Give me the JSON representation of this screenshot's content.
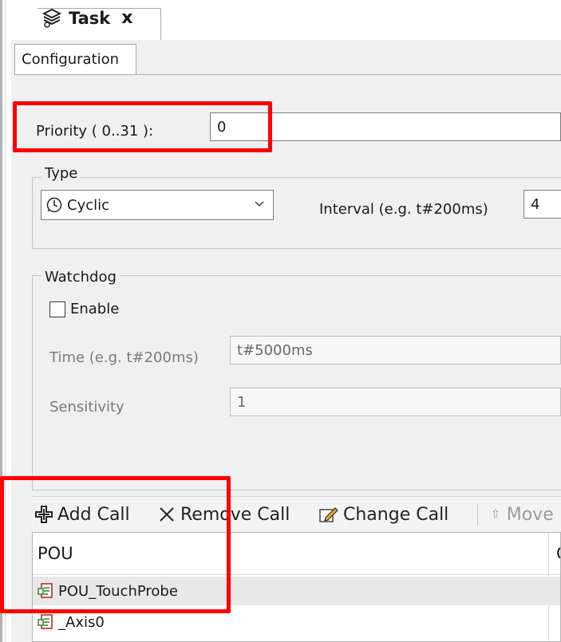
{
  "tab": {
    "title": "Task",
    "close_glyph": "x"
  },
  "config_tab": {
    "label": "Configuration"
  },
  "priority": {
    "label": "Priority ( 0..31 ):",
    "value": "0"
  },
  "type_group": {
    "legend": "Type",
    "selected": "Cyclic",
    "interval_label": "Interval (e.g. t#200ms)",
    "interval_value": "4"
  },
  "watchdog": {
    "legend": "Watchdog",
    "enable_label": "Enable",
    "enabled": false,
    "time_label": "Time (e.g. t#200ms)",
    "time_value": "t#5000ms",
    "sensitivity_label": "Sensitivity",
    "sensitivity_value": "1"
  },
  "toolbar": {
    "add": "Add Call",
    "remove": "Remove Call",
    "change": "Change Call",
    "move": "Move"
  },
  "table": {
    "headers": [
      "POU",
      "C"
    ],
    "rows": [
      "POU_TouchProbe",
      "_Axis0"
    ]
  },
  "colors": {
    "highlight": "#ff0000",
    "panel": "#f0f0f0"
  }
}
